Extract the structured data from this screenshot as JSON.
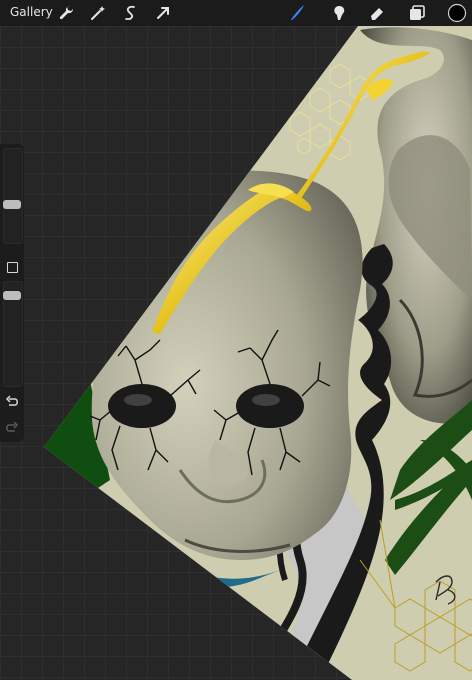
{
  "topbar": {
    "gallery_label": "Gallery",
    "left_icons": [
      "wrench-icon",
      "magic-wand-icon",
      "selection-icon",
      "transform-arrow-icon"
    ],
    "right_icons": [
      "brush-icon",
      "smudge-icon",
      "eraser-icon",
      "layers-icon",
      "color-swatch-icon"
    ],
    "accent_color": "#3b82f6",
    "current_color": "#000000"
  },
  "sidebar": {
    "brush_size": 0.6,
    "brush_opacity": 0.25,
    "icons": [
      "modify-square-icon",
      "undo-icon",
      "redo-icon"
    ]
  },
  "artwork": {
    "signature": "B"
  }
}
